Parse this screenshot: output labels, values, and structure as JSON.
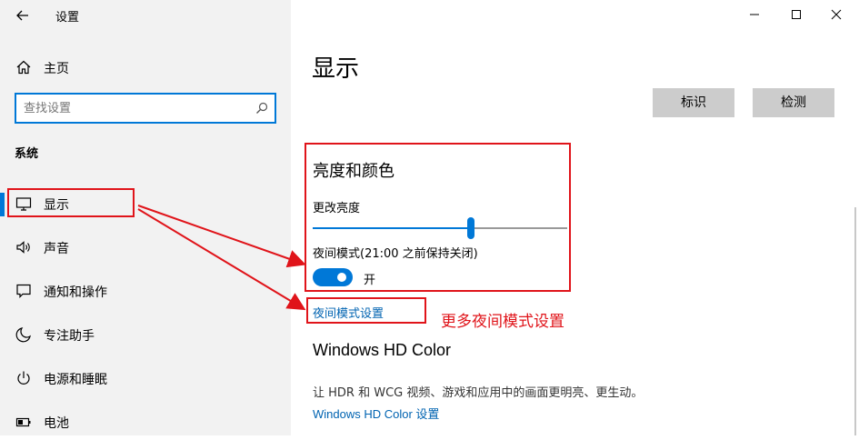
{
  "window": {
    "title": "设置",
    "controls": [
      "minimize",
      "maximize",
      "close"
    ]
  },
  "sidebar": {
    "home_label": "主页",
    "search_placeholder": "查找设置",
    "section_label": "系统",
    "items": [
      {
        "label": "显示",
        "icon": "monitor-icon",
        "selected": true
      },
      {
        "label": "声音",
        "icon": "speaker-icon"
      },
      {
        "label": "通知和操作",
        "icon": "notification-icon"
      },
      {
        "label": "专注助手",
        "icon": "moon-icon"
      },
      {
        "label": "电源和睡眠",
        "icon": "power-icon"
      },
      {
        "label": "电池",
        "icon": "battery-icon"
      }
    ]
  },
  "main": {
    "page_title": "显示",
    "identify_label": "标识",
    "detect_label": "检测",
    "brightness_section_title": "亮度和颜色",
    "brightness_label": "更改亮度",
    "brightness_level": 0.62,
    "night_mode_label": "夜间模式(21:00 之前保持关闭)",
    "night_toggle_label": "开",
    "night_toggle_on": true,
    "night_settings_link": "夜间模式设置",
    "hd_section_title": "Windows HD Color",
    "hd_description": "让 HDR 和 WCG 视频、游戏和应用中的画面更明亮、更生动。",
    "hd_settings_link": "Windows HD Color 设置"
  },
  "annotation": {
    "text": "更多夜间模式设置"
  },
  "colors": {
    "accent": "#0078d7",
    "link": "#0063b1",
    "annotation_red": "#e0141a",
    "sidebar_bg": "#f2f2f2",
    "button_bg": "#cccccc"
  }
}
